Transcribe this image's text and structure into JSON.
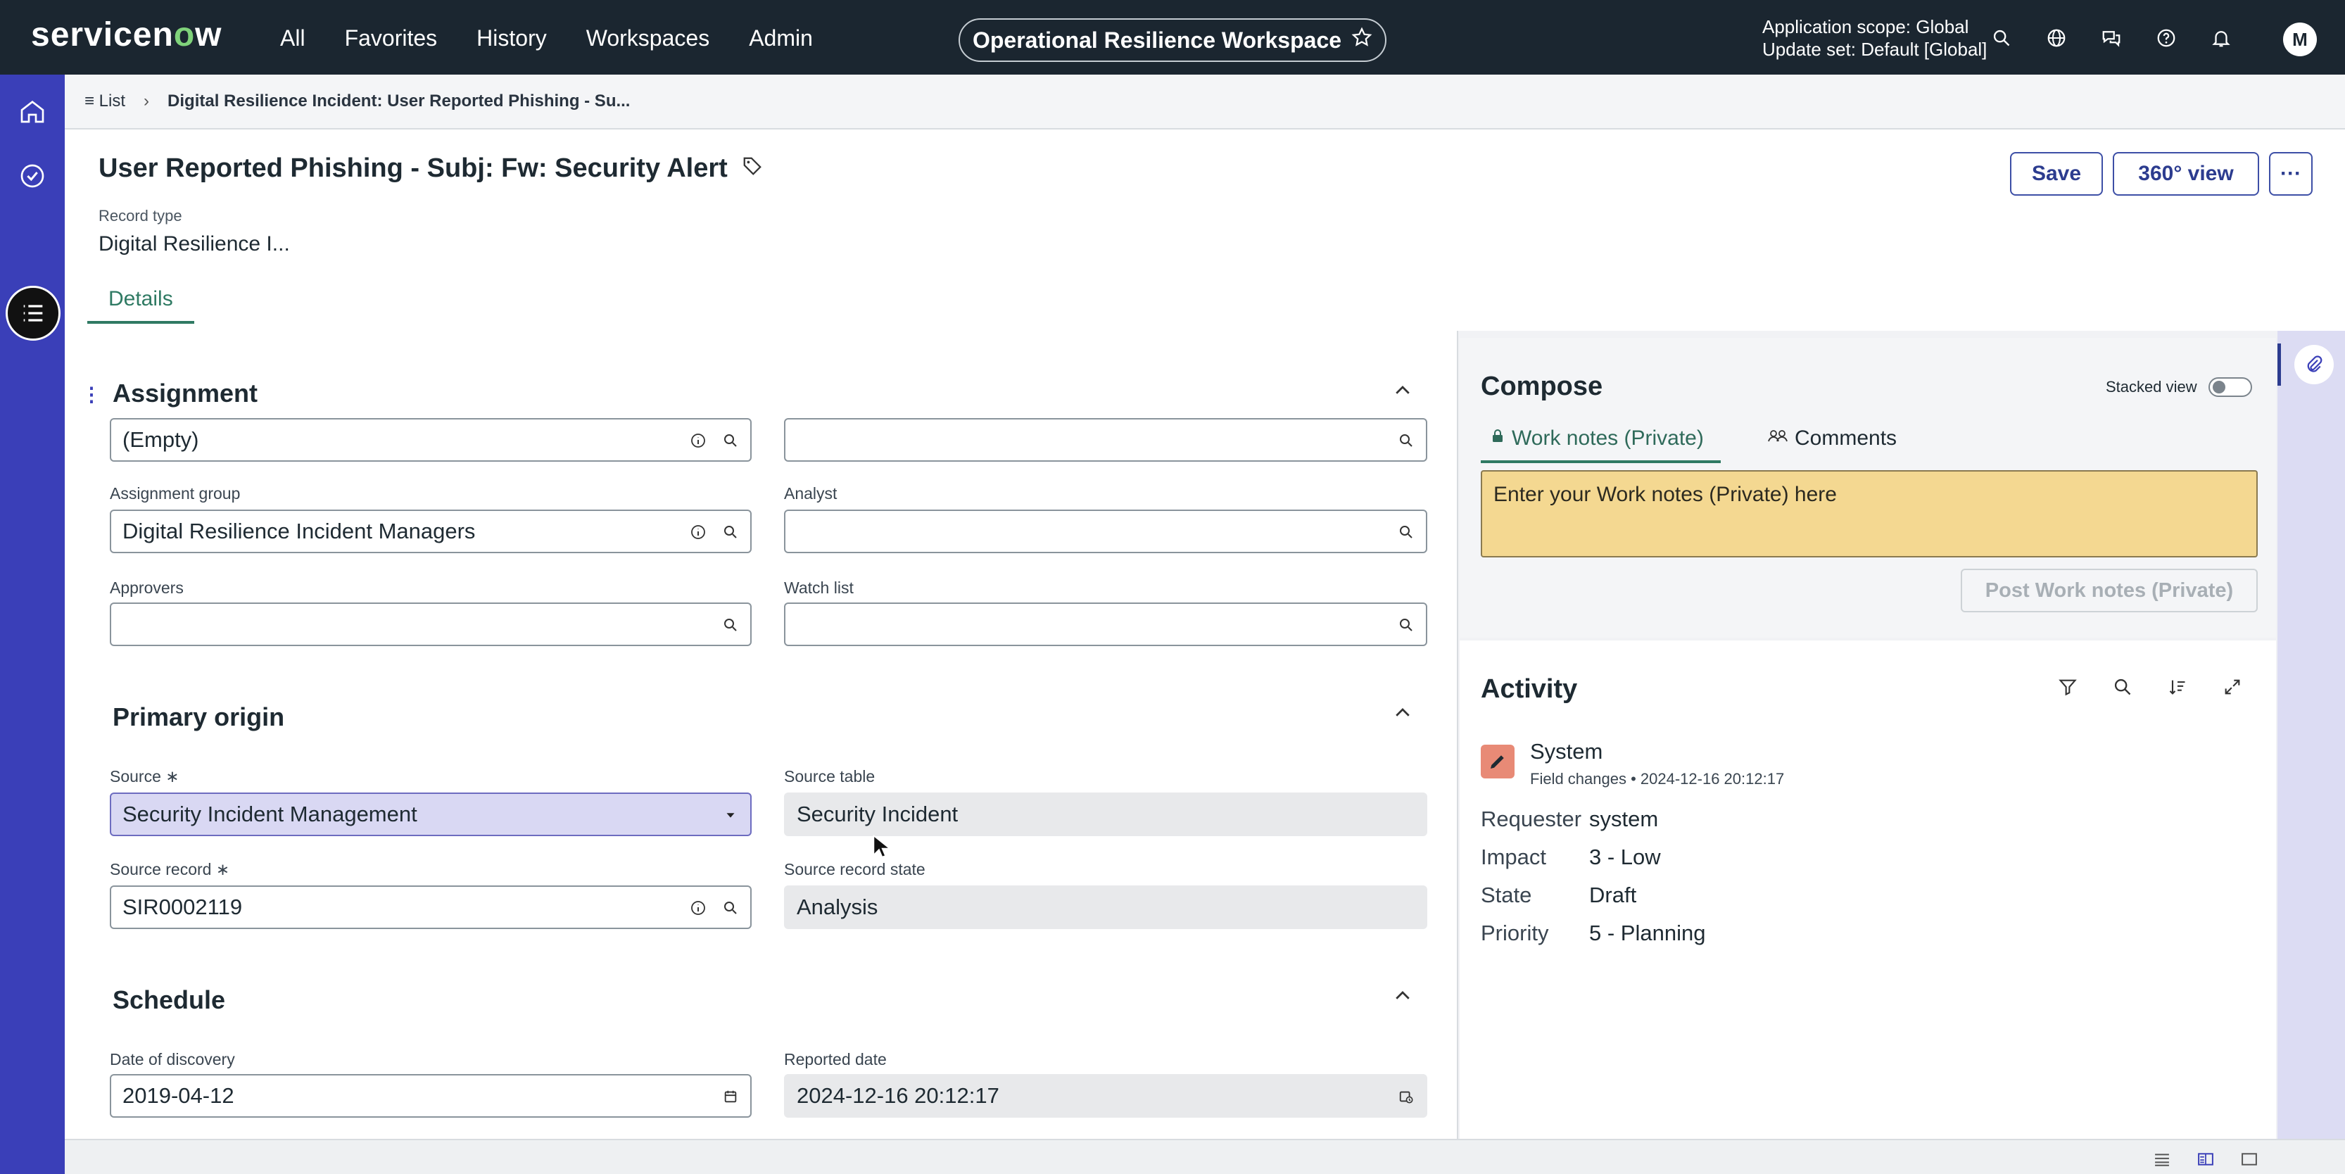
{
  "topnav": {
    "brand_pre": "servicen",
    "brand_o": "o",
    "brand_post": "w",
    "menu": [
      "All",
      "Favorites",
      "History",
      "Workspaces",
      "Admin"
    ],
    "workspace": "Operational Resilience Workspace",
    "scope_line1": "Application scope: Global",
    "scope_line2": "Update set: Default [Global]",
    "avatar_initial": "M"
  },
  "breadcrumb": {
    "list": "List",
    "current": "Digital Resilience Incident: User Reported Phishing - Su..."
  },
  "header": {
    "title": "User Reported Phishing - Subj: Fw: Security Alert",
    "record_type_label": "Record type",
    "record_type_value": "Digital Resilience I...",
    "save": "Save",
    "view360": "360° view",
    "more": "···",
    "tab_details": "Details"
  },
  "assignment": {
    "title": "Assignment",
    "top_left_value": "(Empty)",
    "assignment_group_label": "Assignment group",
    "assignment_group_value": "Digital Resilience Incident Managers",
    "analyst_label": "Analyst",
    "approvers_label": "Approvers",
    "watch_list_label": "Watch list"
  },
  "primary_origin": {
    "title": "Primary origin",
    "source_label": "Source",
    "source_value": "Security Incident Management",
    "source_table_label": "Source table",
    "source_table_value": "Security Incident",
    "source_record_label": "Source record",
    "source_record_value": "SIR0002119",
    "source_record_state_label": "Source record state",
    "source_record_state_value": "Analysis",
    "required_mark": "∗"
  },
  "schedule": {
    "title": "Schedule",
    "date_discovery_label": "Date of discovery",
    "date_discovery_value": "2019-04-12",
    "reported_date_label": "Reported date",
    "reported_date_value": "2024-12-16 20:12:17"
  },
  "compose": {
    "title": "Compose",
    "stacked_view": "Stacked view",
    "tab_work_notes": "Work notes (Private)",
    "tab_comments": "Comments",
    "placeholder": "Enter your Work notes (Private) here",
    "post_button": "Post Work notes (Private)"
  },
  "activity": {
    "title": "Activity",
    "author": "System",
    "meta": "Field changes • 2024-12-16 20:12:17",
    "fields": [
      {
        "k": "Requester",
        "v": "system"
      },
      {
        "k": "Impact",
        "v": "3 - Low"
      },
      {
        "k": "State",
        "v": "Draft"
      },
      {
        "k": "Priority",
        "v": "5 - Planning"
      }
    ]
  },
  "colors": {
    "nav_bg": "#1b2630",
    "rail": "#3a3fb8",
    "accent_green": "#2f7a63",
    "work_notes_bg": "#f4d891"
  }
}
